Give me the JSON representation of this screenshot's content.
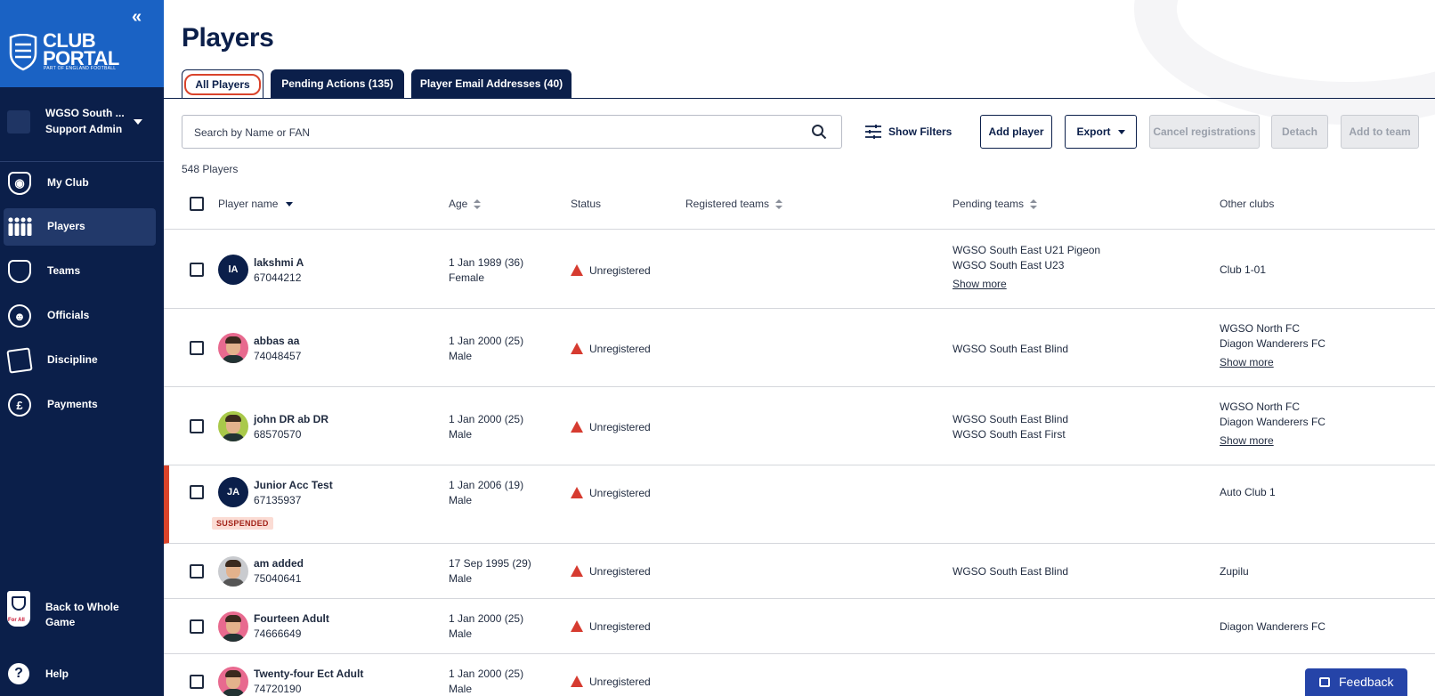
{
  "sidebar": {
    "brand": {
      "line1": "CLUB",
      "line2": "PORTAL",
      "tagline": "PART OF ENGLAND FOOTBALL"
    },
    "account": {
      "club": "WGSO South ...",
      "role": "Support Admin"
    },
    "nav": [
      {
        "label": "My Club",
        "icon": "shield-ball-icon"
      },
      {
        "label": "Players",
        "icon": "players-icon",
        "active": true
      },
      {
        "label": "Teams",
        "icon": "shield-icon"
      },
      {
        "label": "Officials",
        "icon": "officials-icon"
      },
      {
        "label": "Discipline",
        "icon": "cards-icon"
      },
      {
        "label": "Payments",
        "icon": "pound-icon"
      }
    ],
    "back": {
      "line1": "Back to Whole",
      "line2": "Game",
      "crest_text": "For All"
    },
    "help": "Help"
  },
  "page": {
    "title": "Players",
    "tabs": [
      {
        "label": "All Players",
        "active": true
      },
      {
        "label": "Pending Actions (135)"
      },
      {
        "label": "Player Email Addresses (40)"
      }
    ],
    "search_placeholder": "Search by Name or FAN",
    "show_filters": "Show Filters",
    "buttons": {
      "add_player": "Add player",
      "export": "Export",
      "cancel_registrations": "Cancel registrations",
      "detach": "Detach",
      "add_to_team": "Add to team"
    },
    "count": "548 Players"
  },
  "table": {
    "headers": {
      "player_name": "Player name",
      "age": "Age",
      "status": "Status",
      "registered_teams": "Registered teams",
      "pending_teams": "Pending teams",
      "other_clubs": "Other clubs"
    },
    "rows": [
      {
        "name": "lakshmi A",
        "fan": "67044212",
        "initials": "lA",
        "dob": "1 Jan 1989 (36)",
        "gender": "Female",
        "status": "Unregistered",
        "pending": [
          "WGSO South East U21 Pigeon",
          "WGSO South East U23"
        ],
        "pending_more": "Show more",
        "clubs": [
          "Club 1-01"
        ]
      },
      {
        "name": "abbas aa",
        "fan": "74048457",
        "dob": "1 Jan 2000 (25)",
        "gender": "Male",
        "status": "Unregistered",
        "pending": [
          "WGSO South East Blind"
        ],
        "clubs": [
          "WGSO North FC",
          "Diagon Wanderers FC"
        ],
        "clubs_more": "Show more"
      },
      {
        "name": "john DR ab DR",
        "fan": "68570570",
        "dob": "1 Jan 2000 (25)",
        "gender": "Male",
        "status": "Unregistered",
        "pending": [
          "WGSO South East Blind",
          "WGSO South East First"
        ],
        "clubs": [
          "WGSO North FC",
          "Diagon Wanderers FC"
        ],
        "clubs_more": "Show more"
      },
      {
        "name": "Junior Acc Test",
        "fan": "67135937",
        "initials": "JA",
        "badge": "SUSPENDED",
        "dob": "1 Jan 2006 (19)",
        "gender": "Male",
        "status": "Unregistered",
        "clubs": [
          "Auto Club 1"
        ]
      },
      {
        "name": "am added",
        "fan": "75040641",
        "dob": "17 Sep 1995 (29)",
        "gender": "Male",
        "status": "Unregistered",
        "pending": [
          "WGSO South East Blind"
        ],
        "clubs": [
          "Zupilu"
        ]
      },
      {
        "name": "Fourteen Adult",
        "fan": "74666649",
        "dob": "1 Jan 2000 (25)",
        "gender": "Male",
        "status": "Unregistered",
        "clubs": [
          "Diagon Wanderers FC"
        ]
      },
      {
        "name": "Twenty-four Ect Adult",
        "fan": "74720190",
        "dob": "1 Jan 2000 (25)",
        "gender": "Male",
        "status": "Unregistered"
      }
    ]
  },
  "feedback": "Feedback",
  "colors": {
    "navy": "#0b1f4a",
    "brand_blue": "#1a62c4",
    "warning_red": "#d63b30",
    "feedback_blue": "#2544a8"
  }
}
